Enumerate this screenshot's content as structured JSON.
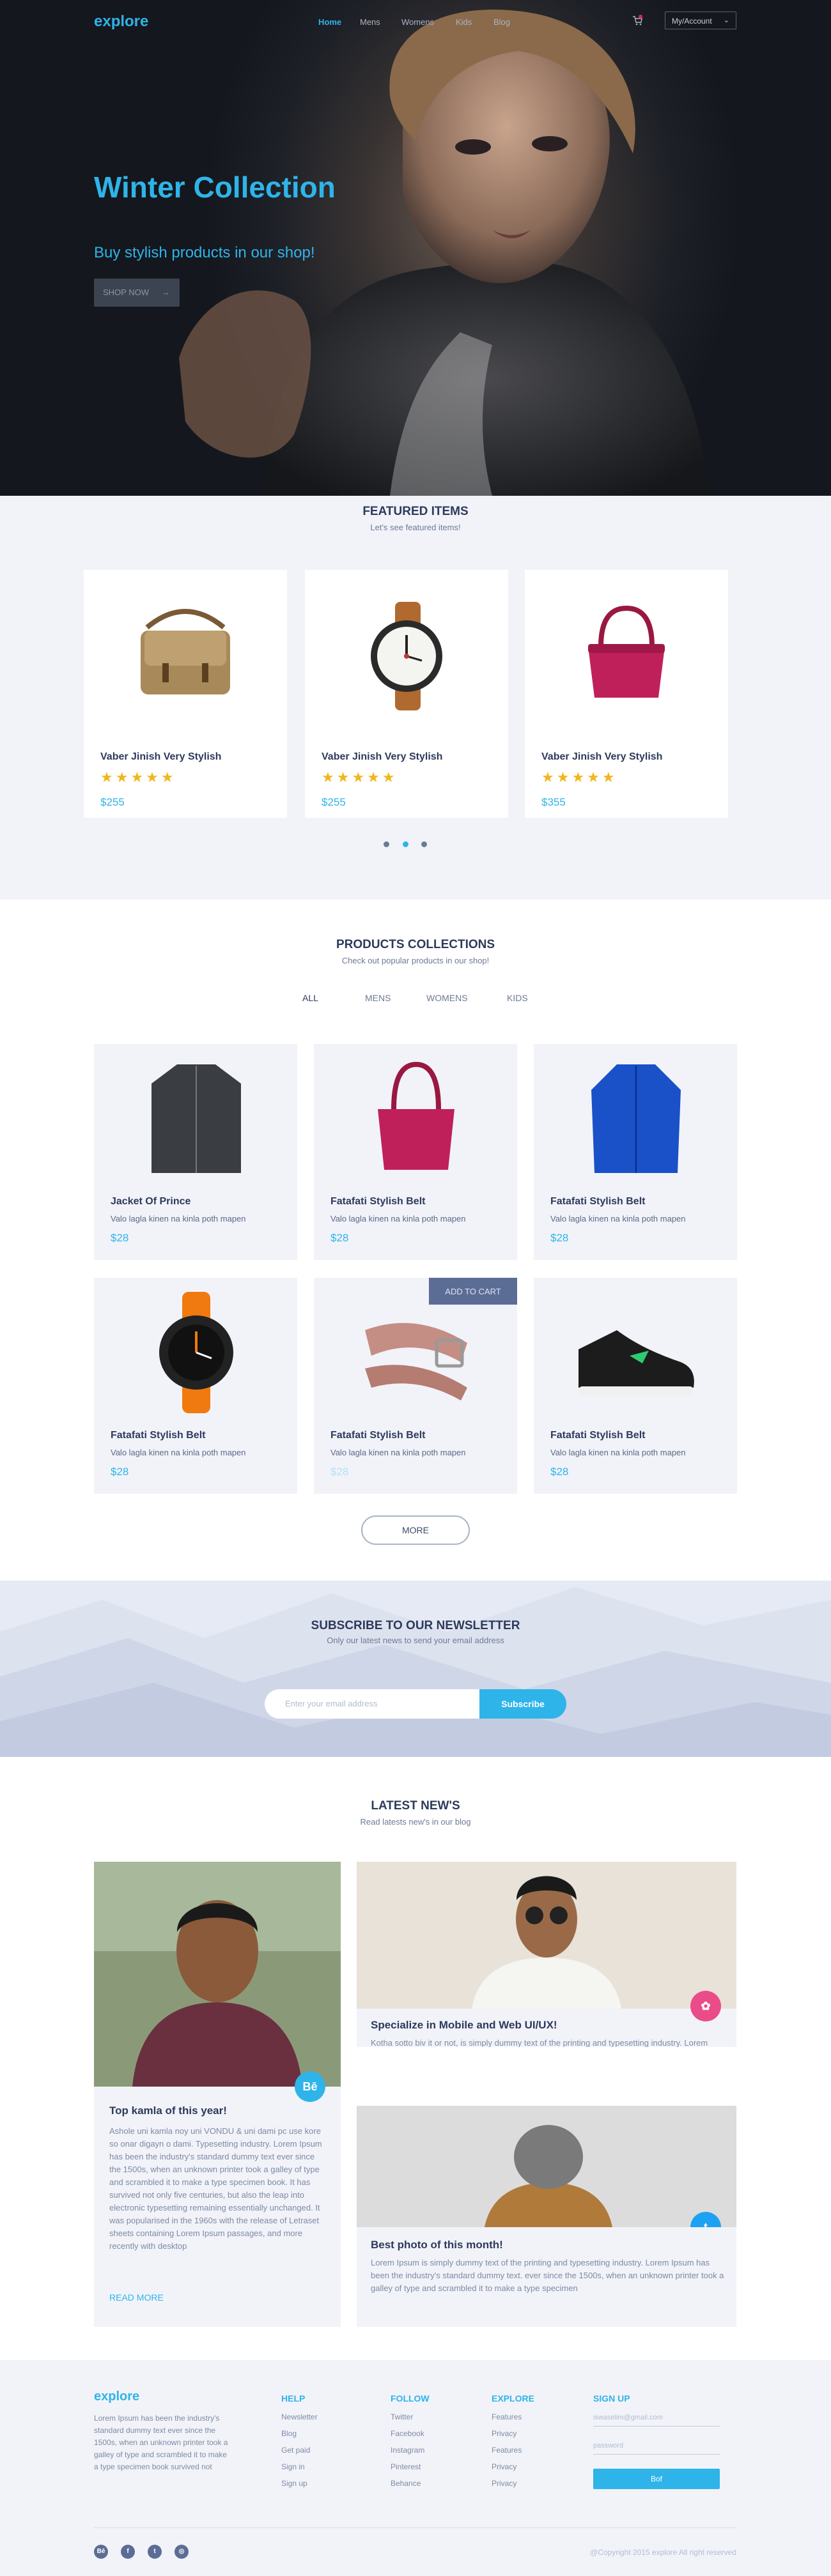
{
  "header": {
    "logo_text": "explore",
    "nav": [
      "Home",
      "Mens",
      "Womens",
      "Kids",
      "Blog"
    ],
    "account_label": "My/Account",
    "icons": [
      "cart-icon",
      "chevron-down-icon"
    ]
  },
  "hero": {
    "title": "Winter Collection",
    "subtitle": "Buy stylish products in our shop!",
    "cta_label": "SHOP NOW",
    "cta_icon": "arrow-right-icon"
  },
  "featured": {
    "title": "FEATURED ITEMS",
    "subtitle": "Let's see featured items!",
    "items": [
      {
        "name": "Vaber Jinish Very Stylish",
        "rating": 5,
        "price": "$255"
      },
      {
        "name": "Vaber Jinish Very Stylish",
        "rating": 5,
        "price": "$255"
      },
      {
        "name": "Vaber Jinish Very Stylish",
        "rating": 5,
        "price": "$355"
      }
    ],
    "carousel_active": 2
  },
  "products": {
    "title": "PRODUCTS COLLECTIONS",
    "subtitle": "Check out popular products in our shop!",
    "filters": [
      "ALL",
      "MENS",
      "WOMENS",
      "KIDS"
    ],
    "add_to_cart_label": "ADD TO CART",
    "more_label": "MORE",
    "items": [
      {
        "name": "Jacket Of Prince",
        "desc": "Valo lagla kinen na kinla poth mapen",
        "price": "$28"
      },
      {
        "name": "Fatafati Stylish Belt",
        "desc": "Valo lagla kinen na kinla poth mapen",
        "price": "$28"
      },
      {
        "name": "Fatafati Stylish Belt",
        "desc": "Valo lagla kinen na kinla poth mapen",
        "price": "$28"
      },
      {
        "name": "Fatafati Stylish Belt",
        "desc": "Valo lagla kinen na kinla poth mapen",
        "price": "$28"
      },
      {
        "name": "Fatafati Stylish Belt",
        "desc": "Valo lagla kinen na kinla poth mapen",
        "price": "$28"
      },
      {
        "name": "Fatafati Stylish Belt",
        "desc": "Valo lagla kinen na kinla poth mapen",
        "price": "$28"
      }
    ]
  },
  "newsletter": {
    "title": "SUBSCRIBE TO OUR NEWSLETTER",
    "subtitle": "Only our latest news to send your email address",
    "placeholder": "Enter your email address",
    "button_label": "Subscribe"
  },
  "news": {
    "title": "LATEST NEW'S",
    "subtitle": "Read latests new's in our blog",
    "posts": [
      {
        "title": "Top kamla of this year!",
        "body": "Ashole uni kamla noy uni VONDU & uni dami pc use kore so onar digayn o dami. Typesetting industry. Lorem Ipsum has been the industry's standard dummy text ever since the 1500s, when an unknown printer took a galley of type and scrambled it to make a type specimen book. It has survived not only five centuries, but also the leap into electronic typesetting remaining essentially unchanged. It was popularised in the 1960s with the release of Letraset sheets containing Lorem Ipsum passages, and more recently with desktop",
        "link": "READ MORE",
        "badge": "Bē"
      },
      {
        "title": "Specialize in Mobile and Web UI/UX!",
        "body": "Kotha sotto biv it or not, is simply dummy text of the printing and typesetting industry. Lorem Ipsum has been the industry's standard dummy text. ever since the 1500s, when an unknown printer took a galley of type and scrambled it to make a",
        "badge": "dribbble-icon"
      },
      {
        "title": "Best photo of this month!",
        "body": "Lorem Ipsum is simply dummy text of the printing and typesetting industry. Lorem Ipsum has been the industry's standard dummy text. ever since the 1500s, when an unknown printer took a galley of type and scrambled it to make a type specimen",
        "badge": "twitter-icon"
      }
    ]
  },
  "footer": {
    "brand": "explore",
    "about": "Lorem Ipsum has been the industry's standard dummy text ever since the 1500s, when an unknown printer took a galley of type and scrambled it to make a type specimen book survived not",
    "columns": [
      {
        "title": "HELP",
        "items": [
          "Newsletter",
          "Blog",
          "Get paid",
          "Sign in",
          "Sign up"
        ]
      },
      {
        "title": "FOLLOW",
        "items": [
          "Twitter",
          "Facebook",
          "Instagram",
          "Pinterest",
          "Behance"
        ]
      },
      {
        "title": "EXPLORE",
        "items": [
          "Features",
          "Privacy",
          "Features",
          "Privacy",
          "Privacy"
        ]
      }
    ],
    "signup": {
      "title": "SIGN UP",
      "email_placeholder": "iswaselim@gmail.com",
      "password_placeholder": "password",
      "button_label": "Bof"
    },
    "socials": [
      "Bē",
      "f",
      "t",
      "◎"
    ],
    "copyright": "@Copyright 2015 explore All right reserved"
  },
  "colors": {
    "accent": "#2fb4e9",
    "dark": "#2d3a5a",
    "panel": "#f1f3f9",
    "star": "#f2b61b"
  }
}
